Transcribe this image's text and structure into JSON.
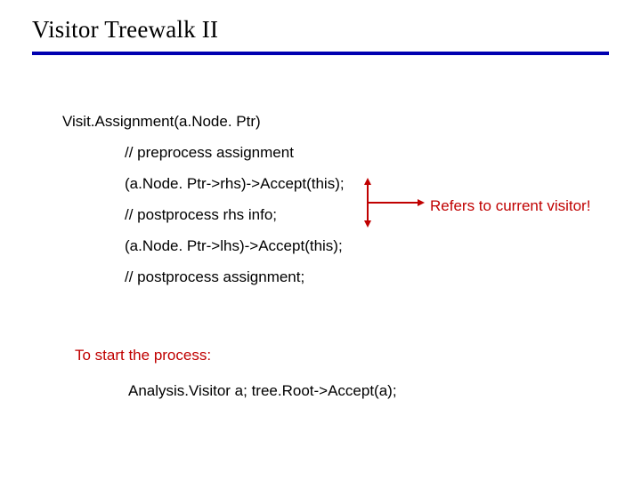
{
  "title": "Visitor Treewalk II",
  "code": {
    "line1": "Visit.Assignment(a.Node. Ptr)",
    "line2": "// preprocess assignment",
    "line3": "(a.Node. Ptr->rhs)->Accept(this);",
    "line4": "// postprocess rhs info;",
    "line5": "(a.Node. Ptr->lhs)->Accept(this);",
    "line6": "// postprocess assignment;"
  },
  "annotation": "Refers to current visitor!",
  "start": {
    "label": "To start the process:",
    "code": "Analysis.Visitor a; tree.Root->Accept(a);"
  },
  "colors": {
    "rule": "#0000b0",
    "accent": "#c00000"
  }
}
